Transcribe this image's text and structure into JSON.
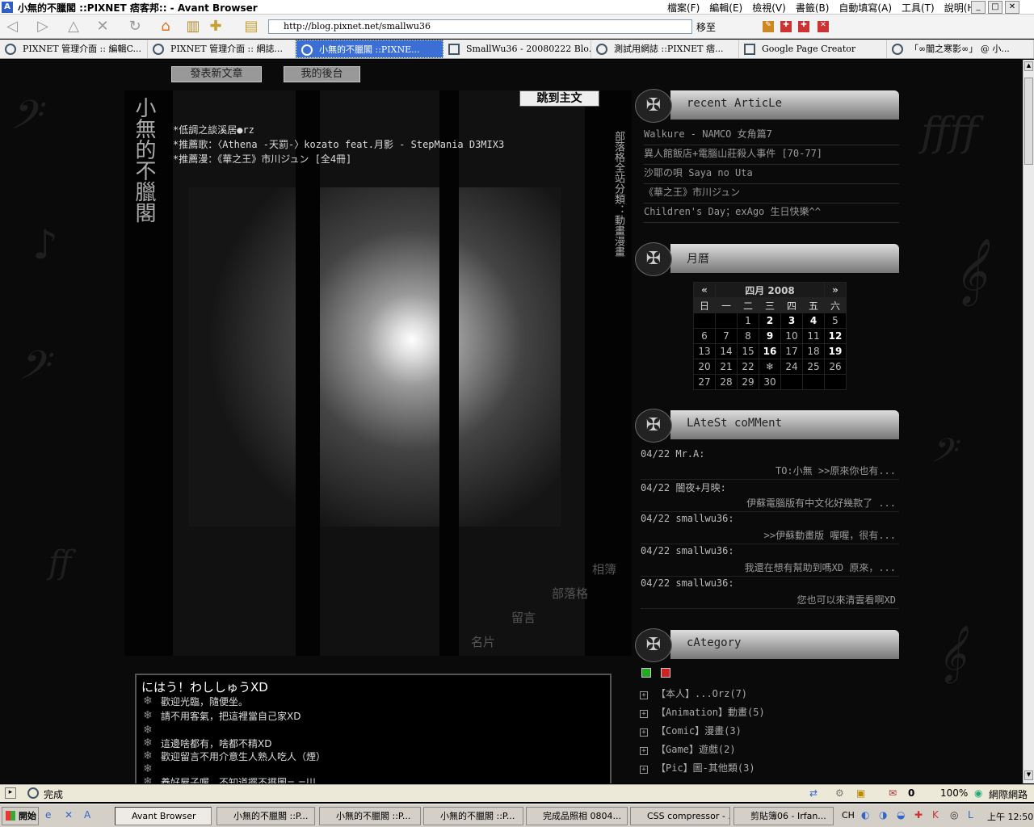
{
  "window": {
    "title": "小無的不臘閣 ::PIXNET 痞客邦:: - Avant Browser",
    "app_icon": "A"
  },
  "menu": [
    "檔案(F)",
    "編輯(E)",
    "檢視(V)",
    "書籤(B)",
    "自動填寫(A)",
    "工具(T)",
    "說明(H)"
  ],
  "address": {
    "url": "http://blog.pixnet.net/smallwu36",
    "go_label": "移至"
  },
  "tabs": [
    {
      "label": "PIXNET 管理介面 :: 編輯C..."
    },
    {
      "label": "PIXNET 管理介面 :: 網誌..."
    },
    {
      "label": "小無的不臘閣 ::PIXNE..."
    },
    {
      "label": "SmallWu36 - 20080222 Blo..."
    },
    {
      "label": "測試用網誌 ::PIXNET 痞..."
    },
    {
      "label": "Google Page Creator"
    },
    {
      "label": "「∞闇之寒影∞」 @ 小..."
    }
  ],
  "blog": {
    "btn_post": "發表新文章",
    "btn_admin": "我的後台",
    "site_title": "小無的不臘閣",
    "jump_main": "跳到主文",
    "desc": [
      "*低調之談溪居●rz",
      "*推薦歌：〈Athena -天罰-〉kozato feat.月影 - StepMania D3MIX3",
      "*推薦漫：《華之王》市川ジュン [全4冊]"
    ],
    "vertical_category": "部落格全站分類：動畫漫畫",
    "nav": {
      "album": "相簿",
      "blog": "部落格",
      "guestbook": "留言",
      "card": "名片"
    }
  },
  "welcome": {
    "title": "にはう！わししゅうXD",
    "lines": [
      "歡迎光臨，隨便坐。",
      "請不用客氣，把這裡當自己家XD",
      "",
      "這邊啥都有，啥都不精XD",
      "歡迎留言不用介意生人熟人吃人（煙）",
      "",
      "養好屋子喔，不知道擺不擺圖= =|||"
    ]
  },
  "sidebar": {
    "recent_title": "recent ArticLe",
    "recent": [
      "Walkure - NAMCO 女角篇7",
      "異人館飯店+電腦山莊殺人事件 [70-77]",
      "沙耶の唄  Saya no Uta",
      "《華之王》市川ジュン",
      "Children's Day；exAgo 生日快樂^^"
    ],
    "calendar_title": "月曆",
    "calendar": {
      "prev": "«",
      "next": "»",
      "month": "四月 2008",
      "weekdays": [
        "日",
        "一",
        "二",
        "三",
        "四",
        "五",
        "六"
      ],
      "weeks": [
        [
          "",
          "",
          "1",
          "2",
          "3",
          "4",
          "5"
        ],
        [
          "6",
          "7",
          "8",
          "9",
          "10",
          "11",
          "12"
        ],
        [
          "13",
          "14",
          "15",
          "16",
          "17",
          "18",
          "19"
        ],
        [
          "20",
          "21",
          "22",
          "❄",
          "24",
          "25",
          "26"
        ],
        [
          "27",
          "28",
          "29",
          "30",
          "",
          "",
          ""
        ]
      ],
      "bold_days": [
        "2",
        "3",
        "4",
        "9",
        "12",
        "16",
        "19"
      ]
    },
    "comment_title": "LAteSt coMMent",
    "comments": [
      {
        "who": "04/22 Mr.A:",
        "text": "TO:小無 >>原來你也有..."
      },
      {
        "who": "04/22 闇夜+月映:",
        "text": "伊蘇電腦版有中文化好幾款了 ..."
      },
      {
        "who": "04/22 smallwu36:",
        "text": ">>伊蘇動畫版 喔喔，很有..."
      },
      {
        "who": "04/22 smallwu36:",
        "text": "我還在想有幫助到嗎XD 原來，..."
      },
      {
        "who": "04/22 smallwu36:",
        "text": "您也可以來清雲看啊XD"
      }
    ],
    "category_title": "cAtegory",
    "categories": [
      "【本人】...Orz(7)",
      "【Animation】動畫(5)",
      "【Comic】漫畫(3)",
      "【Game】遊戲(2)",
      "【Pic】圖-其他類(3)"
    ]
  },
  "status": {
    "text": "完成",
    "count": "0",
    "zoom": "100%",
    "zone": "網際網路"
  },
  "taskbar": {
    "start": "開始",
    "tasks": [
      "Avant Browser",
      "小無的不臘閣 ::P...",
      "小無的不臘閣 ::P...",
      "小無的不臘閣 ::P...",
      "完成品照相 0804...",
      "CSS compressor - ...",
      "剪貼簿06 - Irfan..."
    ],
    "lang": "CH",
    "clock": "上午 12:50"
  }
}
